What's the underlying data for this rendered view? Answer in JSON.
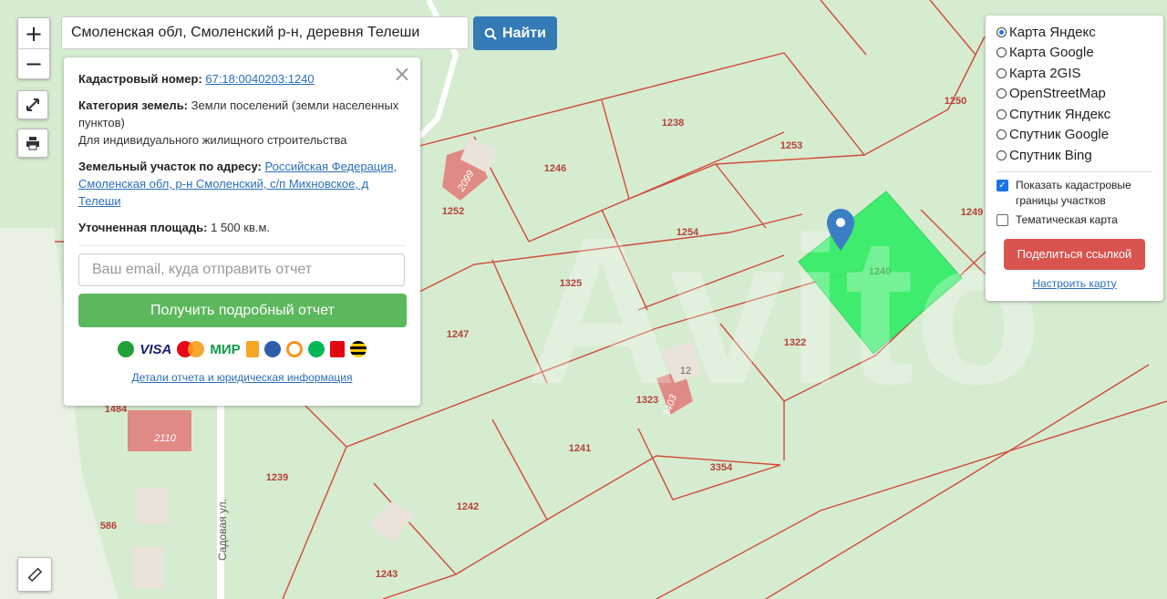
{
  "search": {
    "value": "Смоленская обл, Смоленский р-н, деревня Телеши",
    "button_label": "Найти"
  },
  "zoom": {
    "in_label": "+",
    "out_label": "−"
  },
  "info": {
    "cadastral_label": "Кадастровый номер:",
    "cadastral_value": "67:18:0040203:1240",
    "category_label": "Категория земель:",
    "category_value": "Земли поселений (земли населенных пунктов)",
    "usage_value": "Для индивидуального жилищного строительства",
    "address_label": "Земельный участок по адресу:",
    "address_value": "Российская Федерация, Смоленская обл, р-н Смоленский, с/п Михновское, д Телеши",
    "area_label": "Уточненная площадь:",
    "area_value": "1 500 кв.м.",
    "email_placeholder": "Ваш email, куда отправить отчет",
    "report_button": "Получить подробный отчет",
    "payments": [
      "VISA",
      "МИР"
    ],
    "details_link": "Детали отчета и юридическая информация"
  },
  "layers": {
    "options": [
      "Карта Яндекс",
      "Карта Google",
      "Карта 2GIS",
      "OpenStreetMap",
      "Спутник Яндекс",
      "Спутник Google",
      "Спутник Bing"
    ],
    "selected": "Карта Яндекс",
    "show_borders_label": "Показать кадастровые границы участков",
    "thematic_label": "Тематическая карта",
    "share_button": "Поделиться ссылкой",
    "configure_link": "Настроить карту"
  },
  "map": {
    "parcel_labels": [
      "1238",
      "1253",
      "1250",
      "1246",
      "1252",
      "1254",
      "1249",
      "1240",
      "1325",
      "1247",
      "1322",
      "1323",
      "1484",
      "1241",
      "3354",
      "1239",
      "1242",
      "586",
      "1243"
    ],
    "building_labels": [
      "2099",
      "2110",
      "3403",
      "12"
    ],
    "street_label": "Садовая ул.",
    "watermark": "Avito",
    "colors": {
      "map_bg": "#d6ecd0",
      "parcel_line": "#d04a3a",
      "selected_parcel": "#33ee66",
      "building": "#e08a86",
      "marker": "#3a7fc4"
    }
  }
}
